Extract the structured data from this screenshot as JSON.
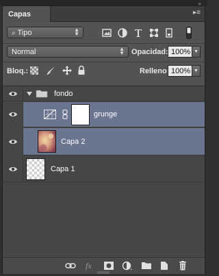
{
  "panel": {
    "tab_label": "Capas",
    "menu_glyph": "▸≡"
  },
  "filter": {
    "kind_label": "Tipo",
    "icons": [
      "search-icon",
      "image-filter-icon",
      "adjustment-filter-icon",
      "type-filter-icon",
      "shape-filter-icon",
      "smart-object-filter-icon",
      "filter-toggle-icon"
    ]
  },
  "blend": {
    "mode": "Normal",
    "opacity_label": "Opacidad:",
    "opacity_value": "100%"
  },
  "lock": {
    "label": "Bloq.:",
    "fill_label": "Relleno:",
    "fill_value": "100%",
    "icons": [
      "lock-transparent-icon",
      "lock-image-icon",
      "lock-position-icon",
      "lock-all-icon"
    ]
  },
  "layers": [
    {
      "name": "fondo",
      "type": "group",
      "visible": true,
      "expanded": true,
      "selected": false
    },
    {
      "name": "grunge",
      "type": "adjustment",
      "visible": true,
      "selected": true,
      "has_mask": true
    },
    {
      "name": "Capa 2",
      "type": "pixel",
      "visible": true,
      "selected": true
    },
    {
      "name": "Capa 1",
      "type": "pixel",
      "visible": true,
      "selected": false
    }
  ],
  "bottom_icons": [
    "link-icon",
    "fx-icon",
    "mask-icon",
    "adjustment-icon",
    "group-folder-icon",
    "new-layer-icon",
    "trash-icon"
  ],
  "colors": {
    "panel_bg": "#535353",
    "selected_bg": "#6a7590",
    "list_bg": "#464646"
  }
}
